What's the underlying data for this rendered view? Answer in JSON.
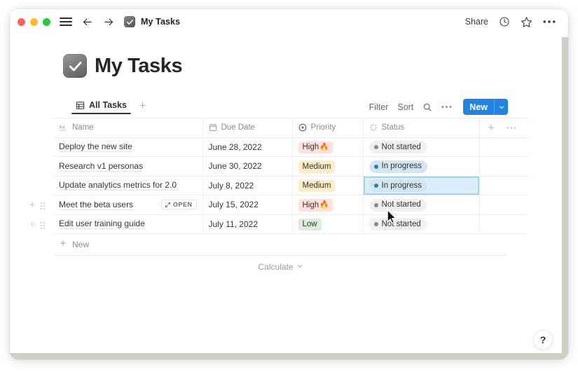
{
  "window": {
    "titlebar": {
      "traffic_lights": [
        "close",
        "minimize",
        "zoom"
      ],
      "menu_icon": "hamburger-menu-icon",
      "back_icon": "arrow-left-icon",
      "forward_icon": "arrow-right-icon",
      "doc_favicon": "checkbox-checked-icon",
      "doc_title": "My Tasks",
      "share_label": "Share",
      "history_icon": "clock-icon",
      "favorite_icon": "star-icon",
      "more_icon": "ellipsis-icon"
    }
  },
  "page": {
    "emoji": "checkbox-checked-icon",
    "title": "My Tasks"
  },
  "db_toolbar": {
    "tabs": [
      {
        "label": "All Tasks",
        "icon": "table-grid-icon",
        "active": true
      }
    ],
    "add_view_icon": "plus-icon",
    "filter_label": "Filter",
    "sort_label": "Sort",
    "search_icon": "search-icon",
    "more_icon": "ellipsis-icon",
    "new_label": "New",
    "new_caret_icon": "chevron-down-icon",
    "new_button_color": "#2383E2"
  },
  "table": {
    "columns": [
      {
        "key": "name",
        "label": "Name",
        "icon": "text-aa-icon"
      },
      {
        "key": "due",
        "label": "Due Date",
        "icon": "calendar-icon"
      },
      {
        "key": "priority",
        "label": "Priority",
        "icon": "target-icon"
      },
      {
        "key": "status",
        "label": "Status",
        "icon": "spinner-icon"
      }
    ],
    "add_column_icon": "plus-icon",
    "column_more_icon": "ellipsis-icon",
    "rows": [
      {
        "name": "Deploy the new site",
        "due": "June 28, 2022",
        "priority": {
          "label": "High",
          "tone": "high",
          "emoji": "🔥"
        },
        "status": {
          "label": "Not started",
          "tone": "notstarted"
        },
        "open_chip": false,
        "gutter": false,
        "selected": false
      },
      {
        "name": "Research v1 personas",
        "due": "June 30, 2022",
        "priority": {
          "label": "Medium",
          "tone": "medium",
          "emoji": ""
        },
        "status": {
          "label": "In progress",
          "tone": "inprogress"
        },
        "open_chip": false,
        "gutter": false,
        "selected": false
      },
      {
        "name": "Update analytics metrics for 2.0",
        "due": "July 8, 2022",
        "priority": {
          "label": "Medium",
          "tone": "medium",
          "emoji": ""
        },
        "status": {
          "label": "In progress",
          "tone": "inprogress"
        },
        "open_chip": false,
        "gutter": false,
        "selected": true
      },
      {
        "name": "Meet the beta users",
        "due": "July 15, 2022",
        "priority": {
          "label": "High",
          "tone": "high",
          "emoji": "🔥"
        },
        "status": {
          "label": "Not started",
          "tone": "notstarted"
        },
        "open_chip": true,
        "open_chip_label": "OPEN",
        "gutter": true,
        "selected": false
      },
      {
        "name": "Edit user training guide",
        "due": "July 11, 2022",
        "priority": {
          "label": "Low",
          "tone": "low",
          "emoji": ""
        },
        "status": {
          "label": "Not started",
          "tone": "notstarted"
        },
        "open_chip": false,
        "gutter": true,
        "selected": false
      }
    ],
    "new_row_label": "New",
    "new_row_icon": "plus-icon",
    "calculate_label": "Calculate",
    "calculate_caret_icon": "chevron-down-icon"
  },
  "help": {
    "label": "?"
  },
  "colors": {
    "accent_blue": "#2383E2",
    "badge_high": "#FFE2DD",
    "badge_medium": "#FDECC8",
    "badge_low": "#DBEDDB",
    "pill_notstarted": "#F1F0EE",
    "pill_inprogress": "#D3E5EF",
    "selection_fill": "#DDEEFB",
    "selection_border": "#9ED5F0",
    "text_primary": "#37352F"
  }
}
